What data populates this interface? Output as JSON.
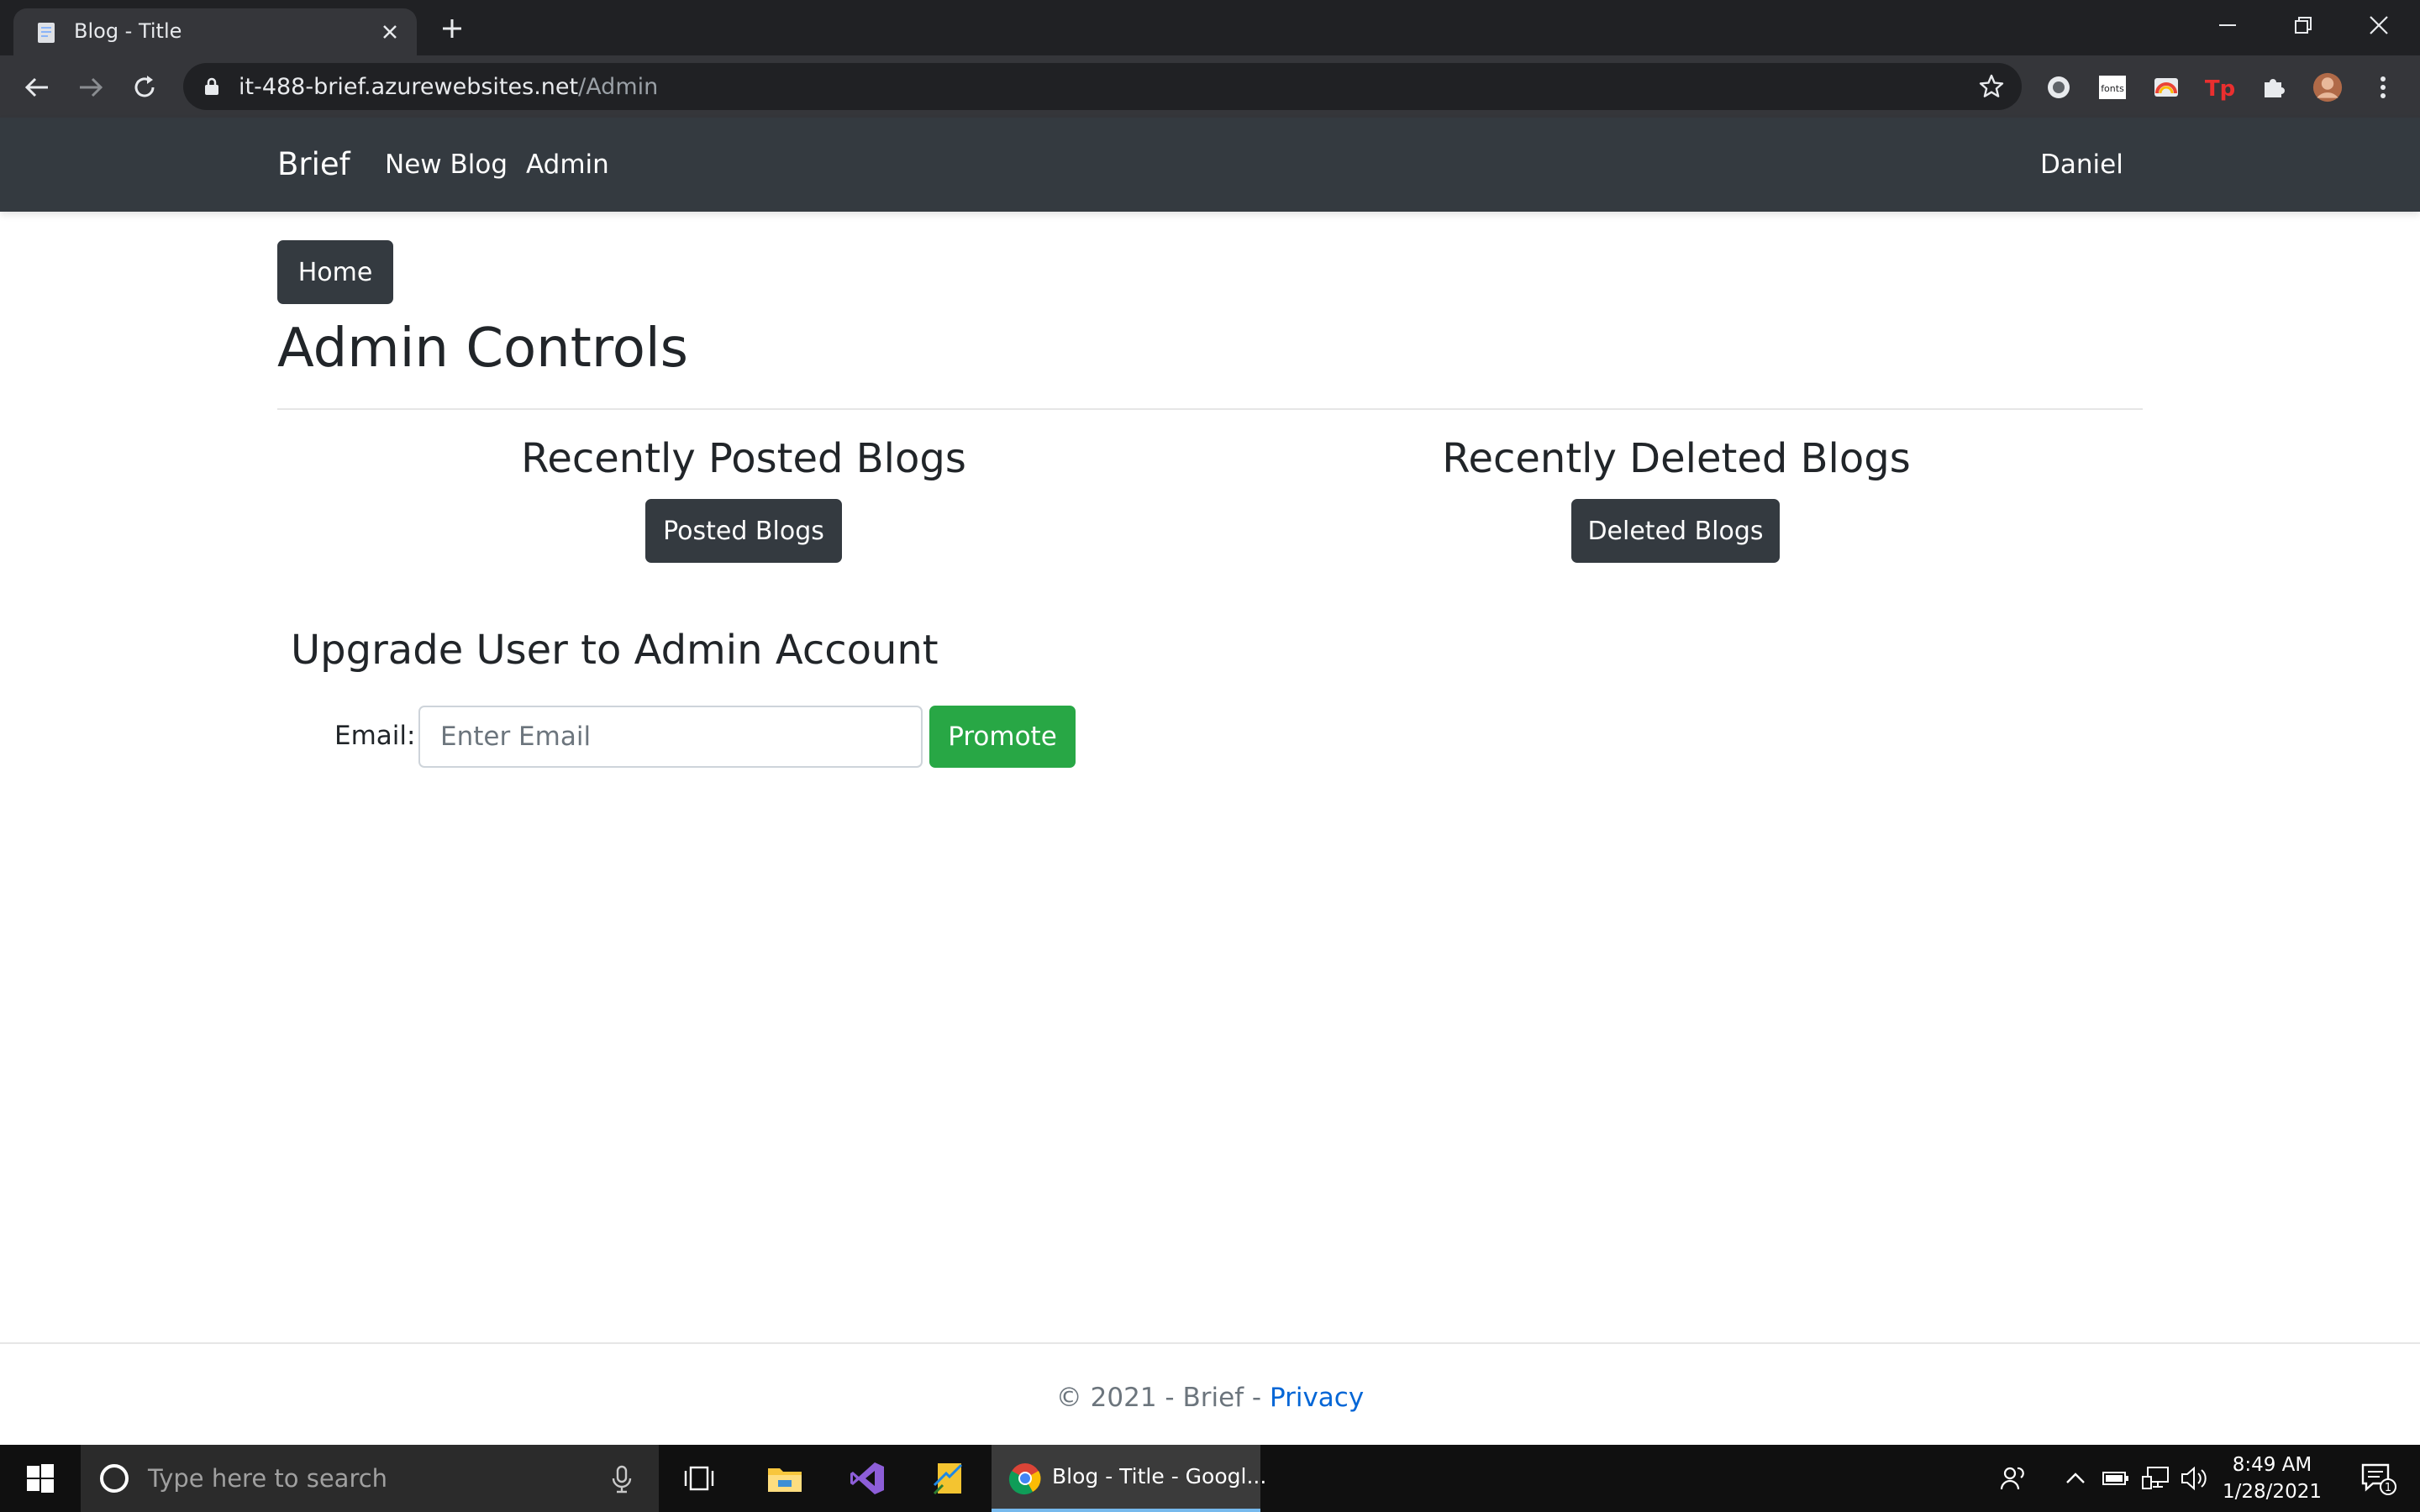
{
  "browser": {
    "tab_title": "Blog - Title",
    "url_host": "it-488-brief.azurewebsites.net",
    "url_path": "/Admin",
    "extension_fonts_label": "fonts",
    "extension_tp_label": "Tp"
  },
  "navbar": {
    "brand": "Brief",
    "links": [
      "New Blog",
      "Admin"
    ],
    "user": "Daniel"
  },
  "main": {
    "home_button": "Home",
    "title": "Admin Controls",
    "posted": {
      "heading": "Recently Posted Blogs",
      "button": "Posted Blogs"
    },
    "deleted": {
      "heading": "Recently Deleted Blogs",
      "button": "Deleted Blogs"
    },
    "upgrade": {
      "heading": "Upgrade User to Admin Account",
      "email_label": "Email:",
      "email_placeholder": "Enter Email",
      "email_value": "",
      "promote_button": "Promote"
    }
  },
  "footer": {
    "text": "© 2021 - Brief - ",
    "privacy_link": "Privacy"
  },
  "taskbar": {
    "search_placeholder": "Type here to search",
    "chrome_label": "Blog - Title - Googl...",
    "time": "8:49 AM",
    "date": "1/28/2021",
    "notification_count": "1"
  },
  "colors": {
    "navbar_bg": "#343a40",
    "btn_dark": "#343a40",
    "btn_success": "#28a745",
    "link": "#0366d6",
    "chrome_frame": "#202124",
    "chrome_toolbar": "#35363a"
  }
}
